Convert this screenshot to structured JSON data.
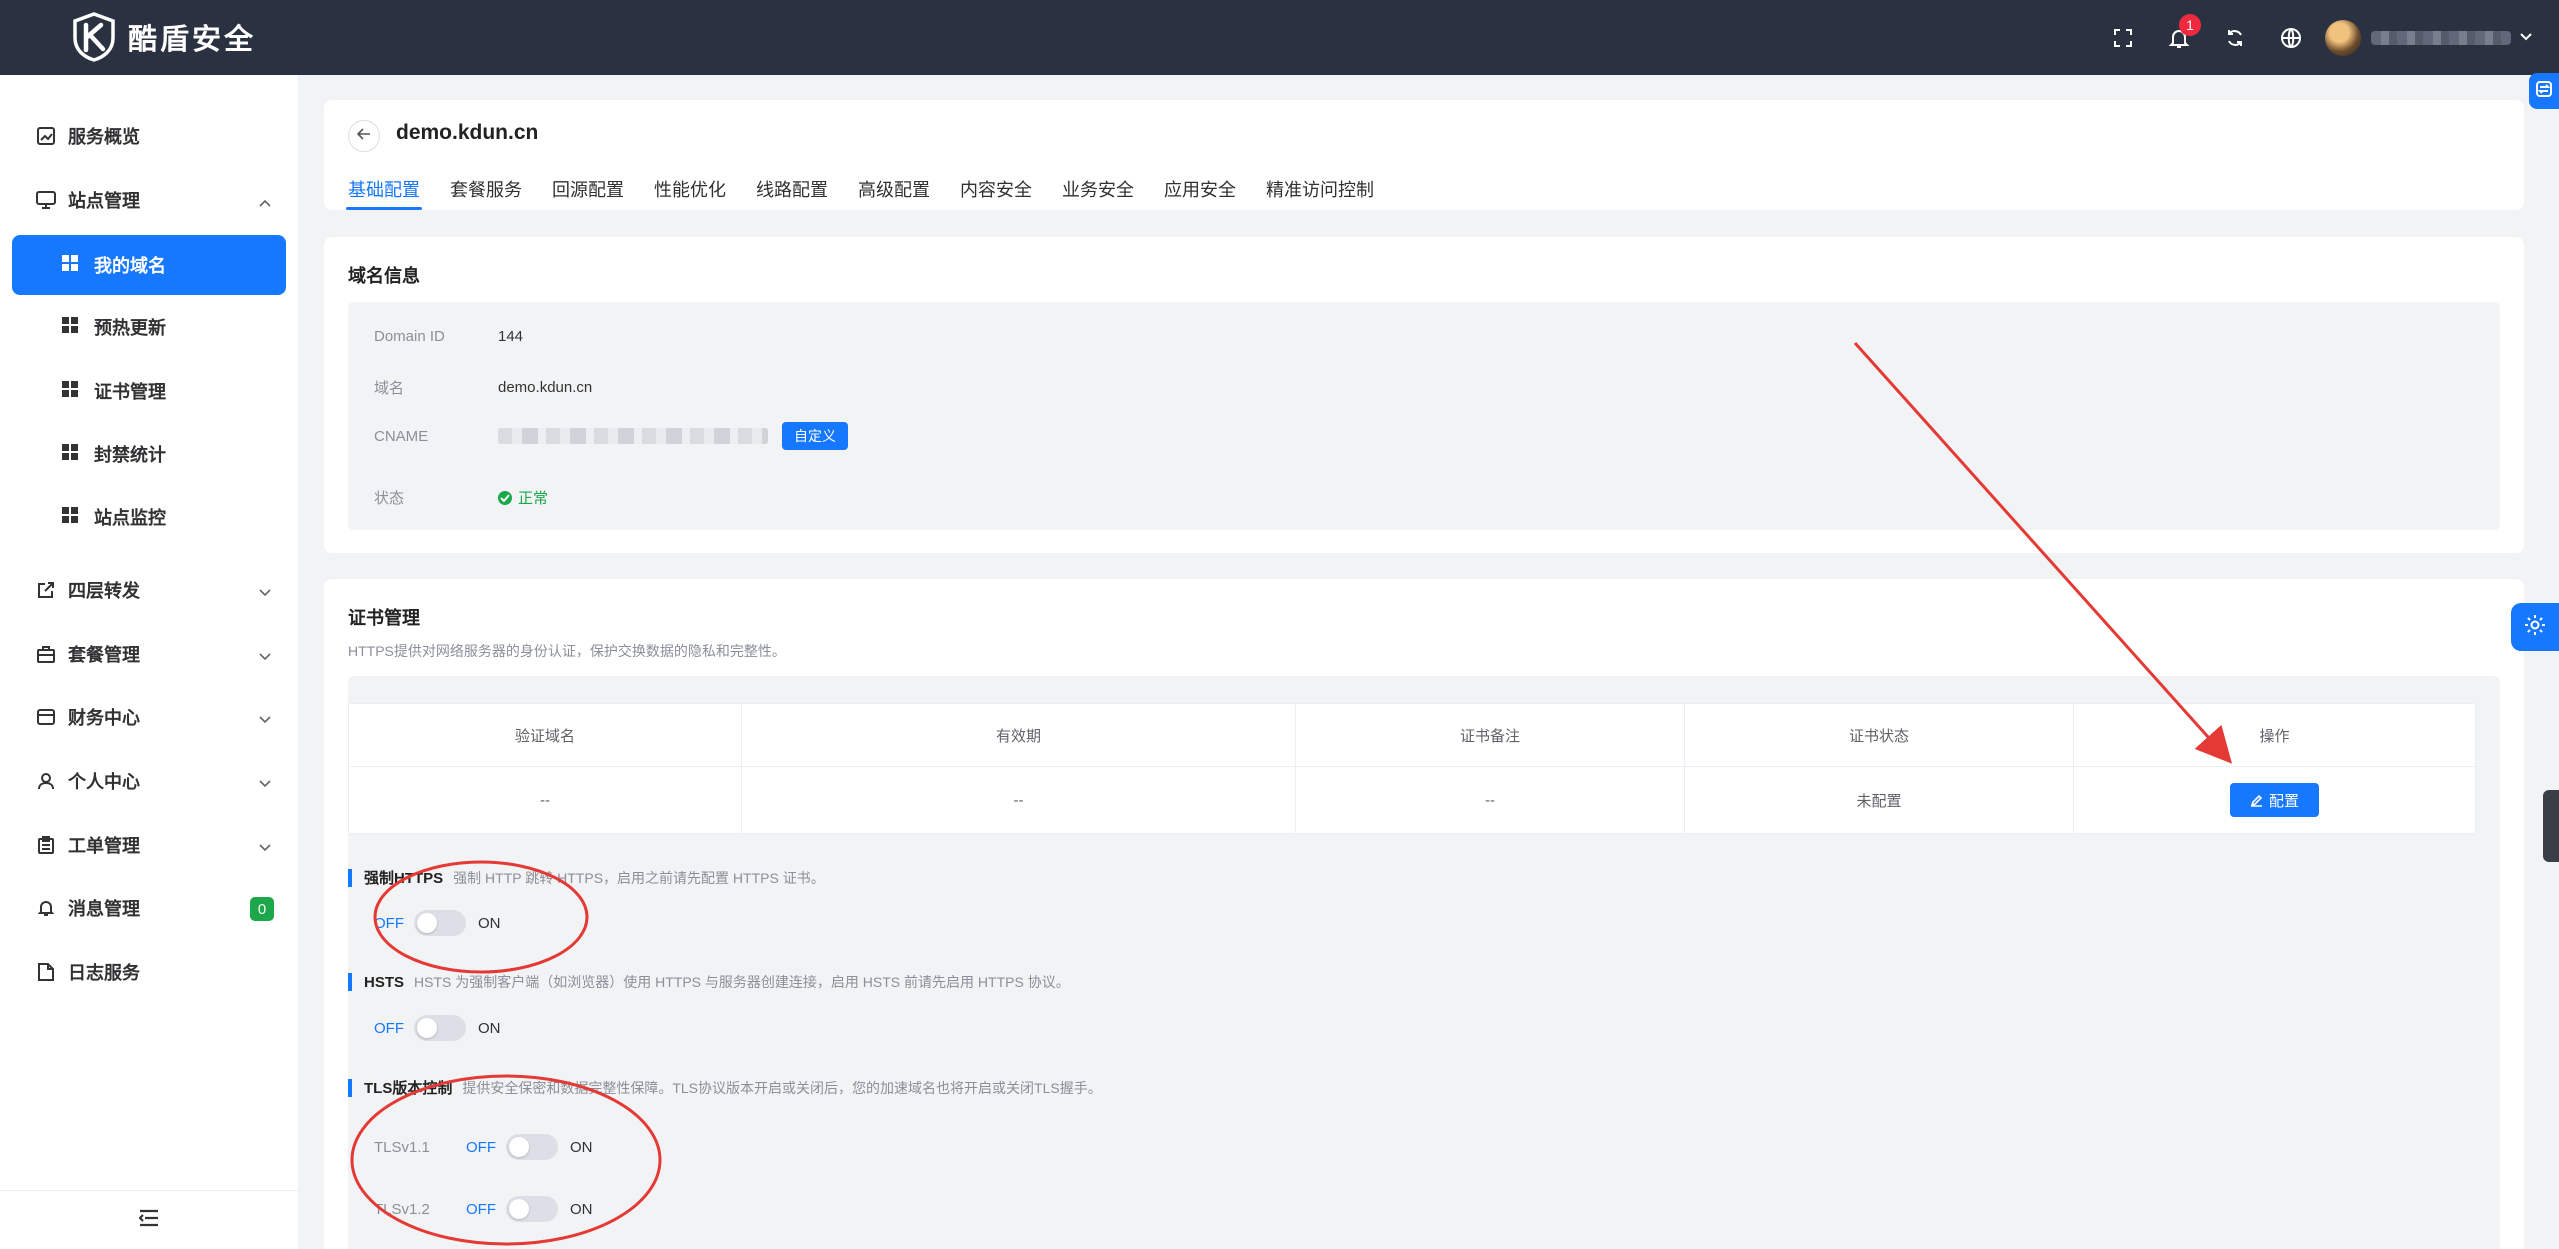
{
  "brand": {
    "name": "酷盾安全"
  },
  "header": {
    "notification_count": "1"
  },
  "sidebar": {
    "items": [
      {
        "label": "服务概览"
      },
      {
        "label": "站点管理"
      },
      {
        "label": "四层转发"
      },
      {
        "label": "套餐管理"
      },
      {
        "label": "财务中心"
      },
      {
        "label": "个人中心"
      },
      {
        "label": "工单管理"
      },
      {
        "label": "消息管理",
        "badge": "0"
      },
      {
        "label": "日志服务"
      }
    ],
    "site_sub_items": [
      {
        "label": "我的域名",
        "active": true
      },
      {
        "label": "预热更新"
      },
      {
        "label": "证书管理"
      },
      {
        "label": "封禁统计"
      },
      {
        "label": "站点监控"
      }
    ]
  },
  "page": {
    "domain": "demo.kdun.cn",
    "tabs": [
      {
        "label": "基础配置",
        "active": true
      },
      {
        "label": "套餐服务"
      },
      {
        "label": "回源配置"
      },
      {
        "label": "性能优化"
      },
      {
        "label": "线路配置"
      },
      {
        "label": "高级配置"
      },
      {
        "label": "内容安全"
      },
      {
        "label": "业务安全"
      },
      {
        "label": "应用安全"
      },
      {
        "label": "精准访问控制"
      }
    ]
  },
  "domain_info": {
    "title": "域名信息",
    "id_label": "Domain ID",
    "id_value": "144",
    "name_label": "域名",
    "name_value": "demo.kdun.cn",
    "cname_label": "CNAME",
    "custom_button": "自定义",
    "status_label": "状态",
    "status_value": "正常"
  },
  "cert": {
    "title": "证书管理",
    "desc": "HTTPS提供对网络服务器的身份认证，保护交换数据的隐私和完整性。",
    "columns": [
      "验证域名",
      "有效期",
      "证书备注",
      "证书状态",
      "操作"
    ],
    "row": {
      "domain": "--",
      "validity": "--",
      "remark": "--",
      "status": "未配置",
      "action": "配置"
    }
  },
  "options": {
    "off": "OFF",
    "on": "ON",
    "force_https": {
      "name": "强制HTTPS",
      "hint": "强制 HTTP 跳转 HTTPS，启用之前请先配置 HTTPS 证书。"
    },
    "hsts": {
      "name": "HSTS",
      "hint": "HSTS 为强制客户端（如浏览器）使用 HTTPS 与服务器创建连接，启用 HSTS 前请先启用 HTTPS 协议。"
    },
    "tls": {
      "name": "TLS版本控制",
      "hint": "提供安全保密和数据完整性保障。TLS协议版本开启或关闭后，您的加速域名也将开启或关闭TLS握手。",
      "v11": "TLSv1.1",
      "v12": "TLSv1.2"
    }
  },
  "colors": {
    "accent": "#1677ff",
    "header_bg": "#2a3242",
    "success": "#19a84a",
    "danger": "#f0293e",
    "annotation": "#e53935"
  }
}
